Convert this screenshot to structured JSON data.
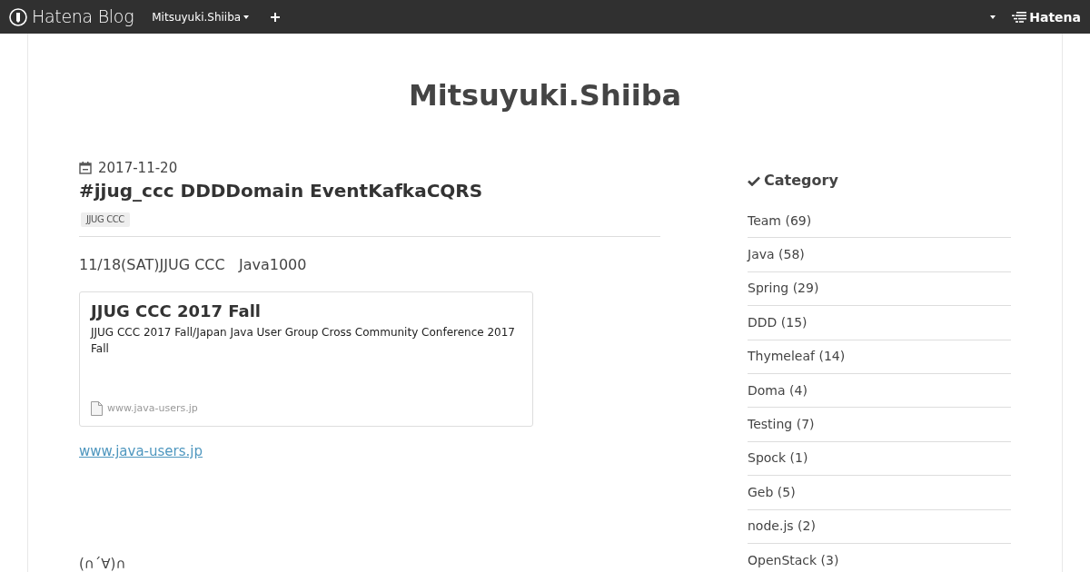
{
  "top_bar": {
    "logo_text": "Hatena Blog",
    "blog_menu": "Mitsuyuki.Shiiba",
    "brand_text": "Hatena"
  },
  "blog_title": "Mitsuyuki.Shiiba",
  "entry": {
    "date": "2017-11-20",
    "title": "#jjug_ccc DDDDomain EventKafkaCQRS",
    "categories": [
      "JJUG CCC"
    ],
    "intro": "11/18(SAT)JJUG CCC   Java1000",
    "embed_card": {
      "title": "JJUG CCC 2017 Fall",
      "description": "JJUG CCC 2017 Fall/Japan Java User Group Cross Community Conference 2017 Fall",
      "site": "www.java-users.jp"
    },
    "link": "www.java-users.jp",
    "closing": "(∩´∀)∩"
  },
  "sidebar": {
    "module_title": "Category",
    "categories": [
      "Team (69)",
      "Java (58)",
      "Spring (29)",
      "DDD (15)",
      "Thymeleaf (14)",
      "Doma (4)",
      "Testing (7)",
      "Spock (1)",
      "Geb (5)",
      "node.js (2)",
      "OpenStack (3)"
    ]
  }
}
